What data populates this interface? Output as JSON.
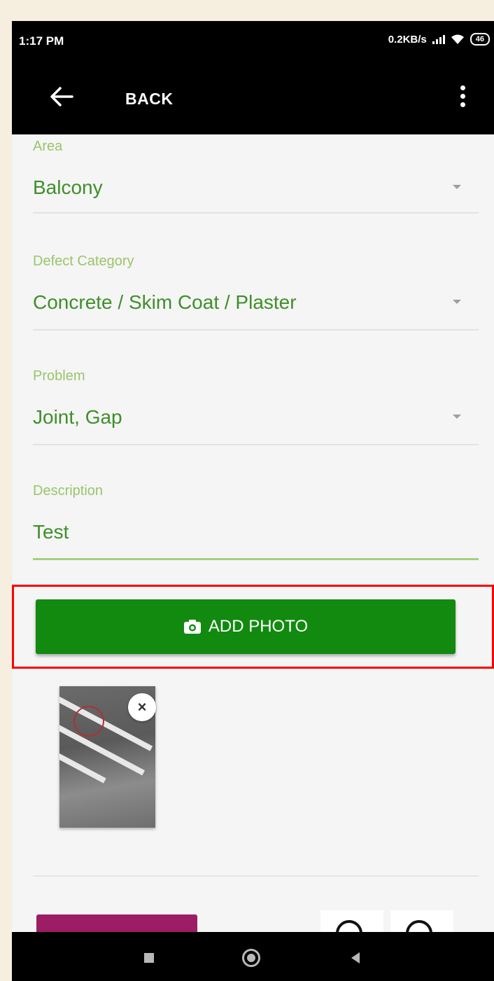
{
  "status_bar": {
    "time": "1:17 PM",
    "network_speed": "0.2KB/s",
    "battery_level": "46",
    "icons": [
      "signal-icon",
      "wifi-icon",
      "battery-icon"
    ]
  },
  "app_bar": {
    "back_label": "BACK",
    "icons": [
      "back-arrow-icon",
      "overflow-menu-icon"
    ]
  },
  "form": {
    "area": {
      "label": "Area",
      "value": "Balcony"
    },
    "defect_category": {
      "label": "Defect Category",
      "value": "Concrete / Skim Coat / Plaster"
    },
    "problem": {
      "label": "Problem",
      "value": "Joint, Gap"
    },
    "description": {
      "label": "Description",
      "value": "Test"
    }
  },
  "add_photo": {
    "label": "ADD PHOTO",
    "icon": "camera-icon"
  },
  "photo": {
    "remove_label": "×"
  },
  "colors": {
    "accent_green": "#118a0f",
    "label_green": "#9bc46a",
    "value_green": "#3e8f2a",
    "highlight_red": "#ff0000",
    "bottom_button": "#9c1d63"
  },
  "nav_bar": {
    "icons": [
      "recents-icon",
      "home-icon",
      "back-icon"
    ]
  }
}
